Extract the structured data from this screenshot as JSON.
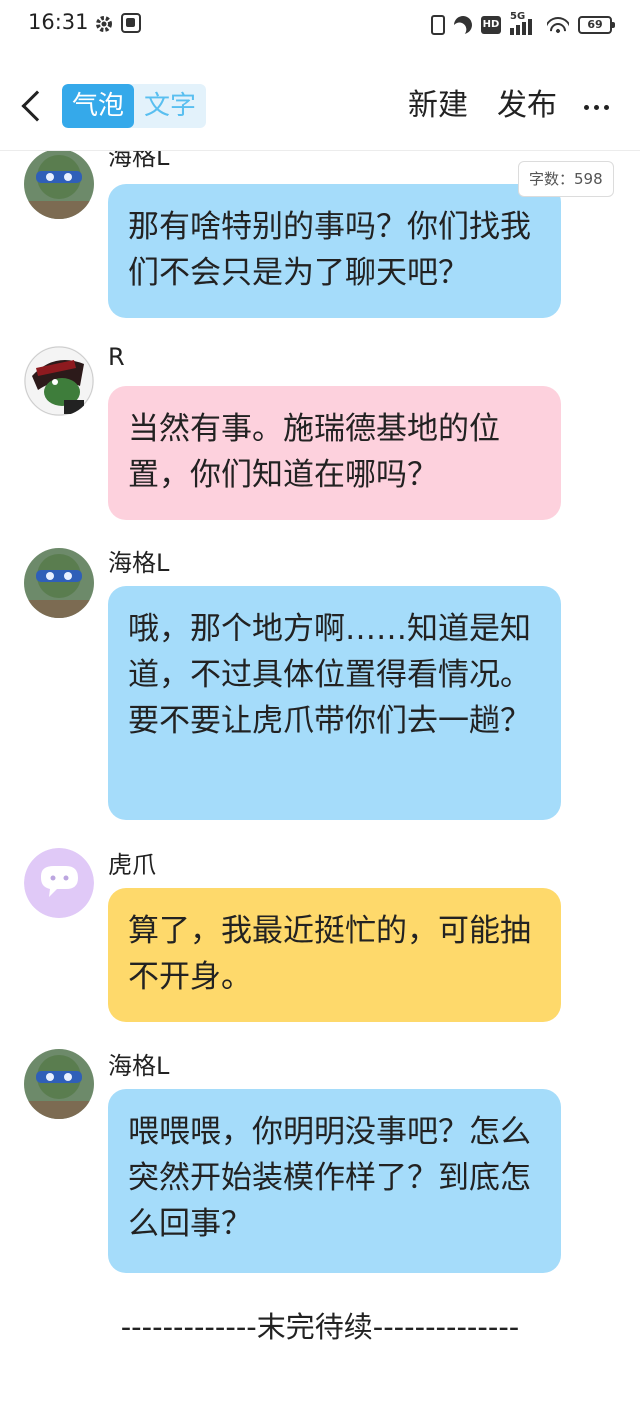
{
  "status_bar": {
    "time": "16:31",
    "network": "5G",
    "hd": "HD",
    "battery": "69"
  },
  "header": {
    "mode_active": "气泡",
    "mode_inactive": "文字",
    "new_label": "新建",
    "publish_label": "发布"
  },
  "word_count": "字数：598",
  "messages": [
    {
      "sender": "海格L",
      "text": "那有啥特别的事吗？你们找我们不会只是为了聊天吧？",
      "color": "#a5dcfa"
    },
    {
      "sender": "R",
      "text": "当然有事。施瑞德基地的位置，你们知道在哪吗？",
      "color": "#fdd1dd"
    },
    {
      "sender": "海格L",
      "text": "哦，那个地方啊……知道是知道，不过具体位置得看情况。要不要让虎爪带你们去一趟？",
      "color": "#a5dcfa"
    },
    {
      "sender": "虎爪",
      "text": "算了，我最近挺忙的，可能抽不开身。",
      "color": "#fed96b"
    },
    {
      "sender": "海格L",
      "text": "喂喂喂，你明明没事吧？怎么突然开始装模作样了？到底怎么回事？",
      "color": "#a5dcfa"
    }
  ],
  "footer": "-------------末完待续--------------",
  "colors": {
    "accent": "#35a9ea",
    "bubble_blue": "#a5dcfa",
    "bubble_pink": "#fdd1dd",
    "bubble_yellow": "#fed96b"
  }
}
